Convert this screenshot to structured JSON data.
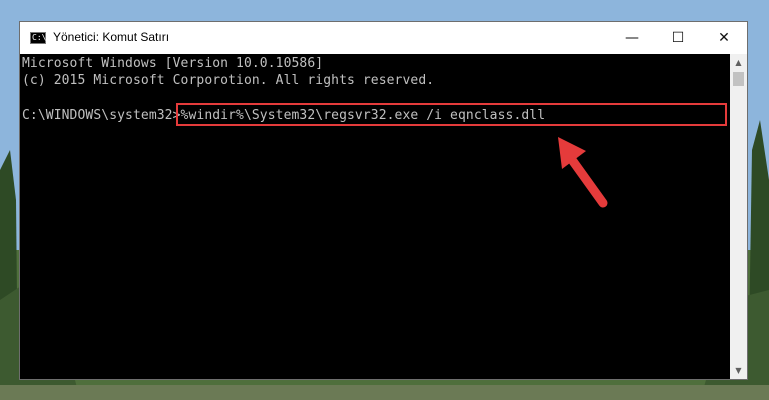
{
  "window": {
    "title": "Yönetici: Komut Satırı",
    "icon": "C:\\",
    "controls": {
      "minimize": "—",
      "maximize": "☐",
      "close": "✕"
    }
  },
  "console": {
    "lines": [
      "Microsoft Windows [Version 10.0.10586]",
      "(c) 2015 Microsoft Corporotion. All rights reserved.",
      "C:\\WINDOWS\\system32>%windir%\\System32\\regsvr32.exe /i eqnclass.dll"
    ]
  },
  "scrollbar": {
    "up": "▲",
    "down": "▼"
  },
  "colors": {
    "console_bg": "#000000",
    "console_text": "#c0c0c0",
    "highlight": "#e53b3b",
    "arrow": "#e53b3b"
  }
}
